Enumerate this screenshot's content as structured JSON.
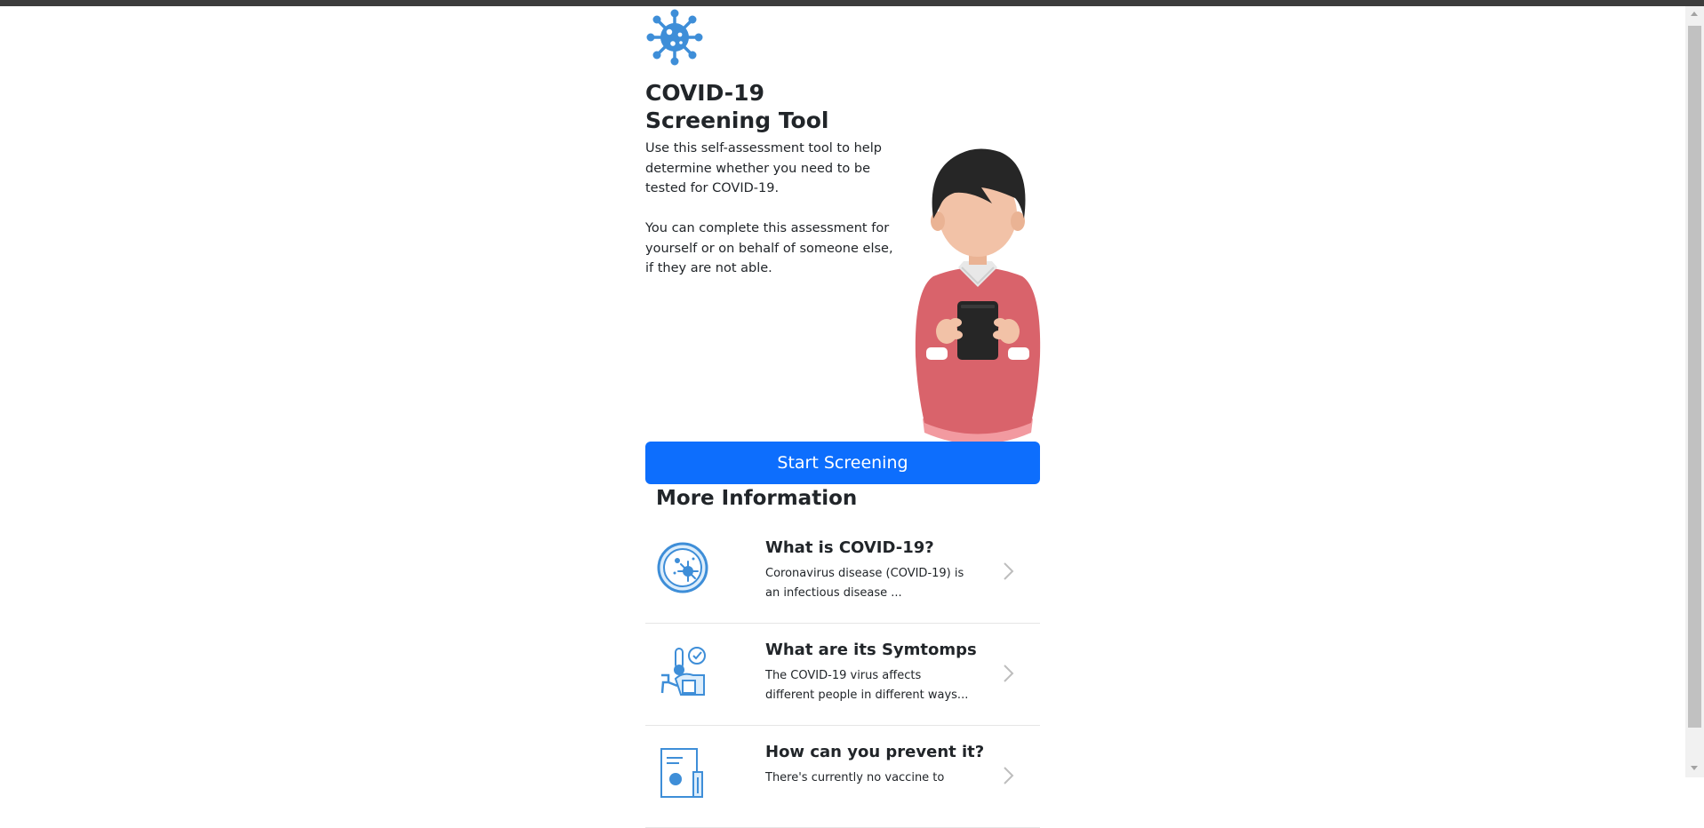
{
  "header": {
    "title_line1": "COVID-19",
    "title_line2": "Screening Tool",
    "paragraph1": "Use this self-assessment tool to help determine whether you need to be tested for COVID-19.",
    "paragraph2": "You can complete this assessment for yourself or on behalf of someone else, if they are not able."
  },
  "start_button": {
    "label": "Start Screening"
  },
  "more_info": {
    "title": "More Information",
    "items": [
      {
        "title": "What is COVID-19?",
        "description": "Coronavirus disease (COVID-19) is an infectious disease ...",
        "icon": "virus-magnifier-icon"
      },
      {
        "title": "What are its Symtomps",
        "description": "The COVID-19 virus affects different people in different ways...",
        "icon": "thermometer-patient-icon"
      },
      {
        "title": "How can you prevent it?",
        "description": "There's currently no vaccine to",
        "icon": "document-chart-icon"
      }
    ]
  },
  "colors": {
    "primary": "#0d6efd",
    "icon_blue": "#3e8ed8",
    "sweater": "#d9636b",
    "hair": "#262626",
    "skin": "#f2c2a7"
  }
}
